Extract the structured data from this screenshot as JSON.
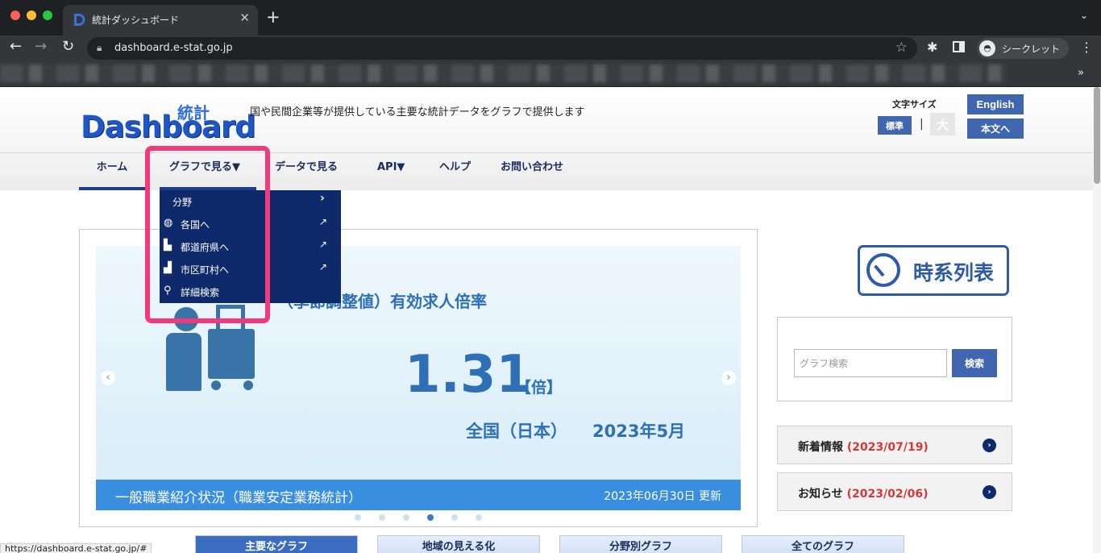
{
  "browser": {
    "tab_title": "統計ダッシュボード",
    "tab_close": "✕",
    "new_tab": "+",
    "url": "dashboard.e-stat.go.jp",
    "incognito_label": "シークレット",
    "status_url": "https://dashboard.e-stat.go.jp/#"
  },
  "header": {
    "logo_main": "Dashboard",
    "logo_kanji": "統計",
    "tagline": "国や民間企業等が提供している主要な統計データをグラフで提供します",
    "font_size_label": "文字サイズ",
    "font_standard": "標準",
    "separator": "|",
    "font_large": "大",
    "english": "English",
    "skip_to_content": "本文へ"
  },
  "nav": {
    "home": "ホーム",
    "graph": "グラフで見る▼",
    "data": "データで見る",
    "api": "API▼",
    "help": "ヘルプ",
    "contact": "お問い合わせ"
  },
  "dropdown": {
    "items": [
      {
        "label": "分野",
        "icon": "chevron-right-icon"
      },
      {
        "label": "各国へ",
        "icon": "globe-icon"
      },
      {
        "label": "都道府県へ",
        "icon": "prefecture-icon"
      },
      {
        "label": "市区町村へ",
        "icon": "city-icon"
      },
      {
        "label": "詳細検索",
        "icon": "search-icon"
      }
    ]
  },
  "slide": {
    "title": "（季節調整値）有効求人倍率",
    "value": "1.31",
    "unit": "【倍】",
    "region": "全国（日本）",
    "date": "2023年5月",
    "source": "一般職業紹介状況（職業安定業務統計）",
    "updated": "2023年06月30日 更新",
    "total_slides": 6,
    "active_slide": 4
  },
  "sidebar": {
    "timeseries_label": "時系列表",
    "search_placeholder": "グラフ検索",
    "search_button": "検索",
    "news": [
      {
        "label": "新着情報",
        "date": "(2023/07/19)"
      },
      {
        "label": "お知らせ",
        "date": "(2023/02/06)"
      }
    ]
  },
  "bottom_tabs": [
    "主要なグラフ",
    "地域の見える化",
    "分野別グラフ",
    "全てのグラフ"
  ],
  "colors": {
    "navy": "#0f2a6b",
    "accent_blue": "#4066b0",
    "slide_text": "#2e6fb6",
    "highlight": "#f23a7a",
    "news_date": "#d23a3a"
  }
}
